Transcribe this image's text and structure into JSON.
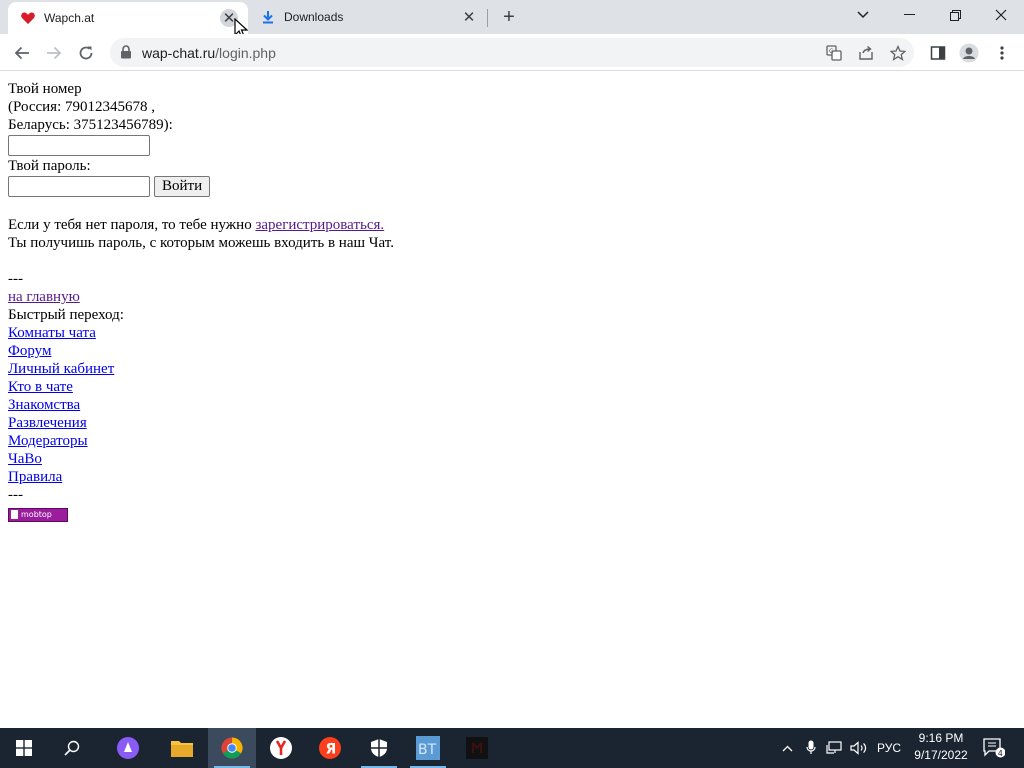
{
  "browser": {
    "tabs": [
      {
        "title": "Wapch.at",
        "active": true,
        "favicon": "heart-icon"
      },
      {
        "title": "Downloads",
        "active": false,
        "favicon": "download-icon"
      }
    ],
    "url_host": "wap-chat.ru",
    "url_path": "/login.php"
  },
  "login": {
    "number_label_1": "Твой номер",
    "number_label_2": "(Россия: 79012345678 ,",
    "number_label_3": "Беларусь: 375123456789):",
    "number_value": "",
    "password_label": "Твой пароль:",
    "password_value": "",
    "login_button": "Войти"
  },
  "register": {
    "text_before": "Если у тебя нет пароля, то тебе нужно ",
    "link": "зарегистрироваться.",
    "text_after": "Ты получишь пароль, с которым можешь входить в наш Чат."
  },
  "separator": "---",
  "home_link": "на главную",
  "quick_nav_label": "Быстрый переход:",
  "quick_nav": [
    "Комнаты чата",
    "Форум",
    "Личный кабинет",
    "Кто в чате",
    "Знакомства",
    "Развлечения",
    "Модераторы",
    "ЧаВо",
    "Правила"
  ],
  "counter_badge": "mobtop",
  "taskbar": {
    "language": "РУС",
    "time": "9:16 PM",
    "date": "9/17/2022",
    "notifications": "4"
  }
}
